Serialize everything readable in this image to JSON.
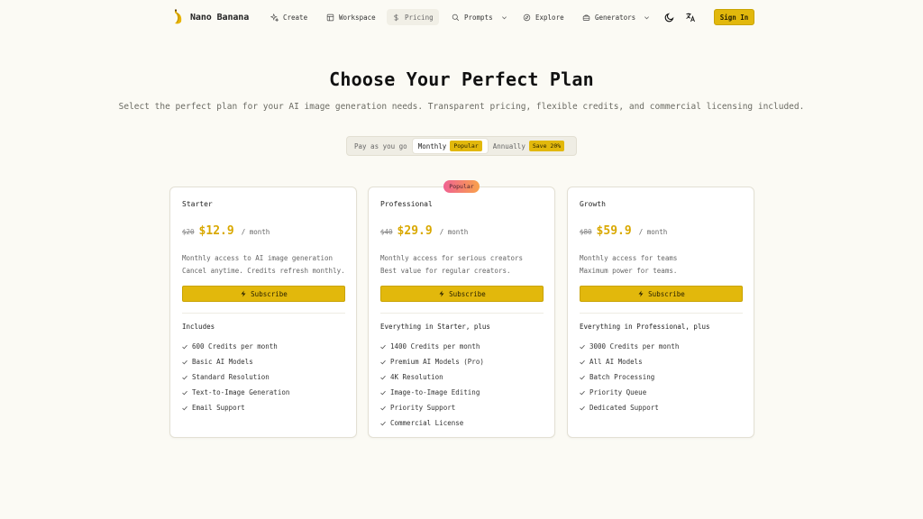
{
  "nav": {
    "brand": "Nano Banana",
    "items": [
      {
        "label": "Create",
        "icon": "sparkles-icon"
      },
      {
        "label": "Workspace",
        "icon": "workspace-icon"
      },
      {
        "label": "Pricing",
        "icon": "dollar-icon"
      },
      {
        "label": "Prompts",
        "icon": "search-icon"
      },
      {
        "label": "Explore",
        "icon": "compass-icon"
      },
      {
        "label": "Generators",
        "icon": "generator-icon"
      }
    ],
    "sign_in": "Sign In"
  },
  "hero": {
    "title": "Choose Your Perfect Plan",
    "subtitle": "Select the perfect plan for your AI image generation needs. Transparent pricing, flexible credits, and commercial licensing included."
  },
  "billing": {
    "options": [
      {
        "label": "Pay as you go"
      },
      {
        "label": "Monthly",
        "badge": "Popular"
      },
      {
        "label": "Annually",
        "badge": "Save 20%"
      }
    ],
    "selected": "Monthly"
  },
  "colors": {
    "accent": "#e2b80c",
    "price": "#d9a800",
    "background": "#fbfaf4"
  },
  "plans": [
    {
      "name": "Starter",
      "old_price": "$20",
      "price": "$12.9",
      "period": "/ month",
      "desc1": "Monthly access to AI image generation",
      "desc2": "Cancel anytime. Credits refresh monthly.",
      "cta": "Subscribe",
      "includes_title": "Includes",
      "features": [
        "600 Credits per month",
        "Basic AI Models",
        "Standard Resolution",
        "Text-to-Image Generation",
        "Email Support"
      ]
    },
    {
      "name": "Professional",
      "badge": "Popular",
      "old_price": "$40",
      "price": "$29.9",
      "period": "/ month",
      "desc1": "Monthly access for serious creators",
      "desc2": "Best value for regular creators.",
      "cta": "Subscribe",
      "includes_title": "Everything in Starter, plus",
      "features": [
        "1400 Credits per month",
        "Premium AI Models (Pro)",
        "4K Resolution",
        "Image-to-Image Editing",
        "Priority Support",
        "Commercial License"
      ]
    },
    {
      "name": "Growth",
      "old_price": "$80",
      "price": "$59.9",
      "period": "/ month",
      "desc1": "Monthly access for teams",
      "desc2": "Maximum power for teams.",
      "cta": "Subscribe",
      "includes_title": "Everything in Professional, plus",
      "features": [
        "3000 Credits per month",
        "All AI Models",
        "Batch Processing",
        "Priority Queue",
        "Dedicated Support"
      ]
    }
  ]
}
